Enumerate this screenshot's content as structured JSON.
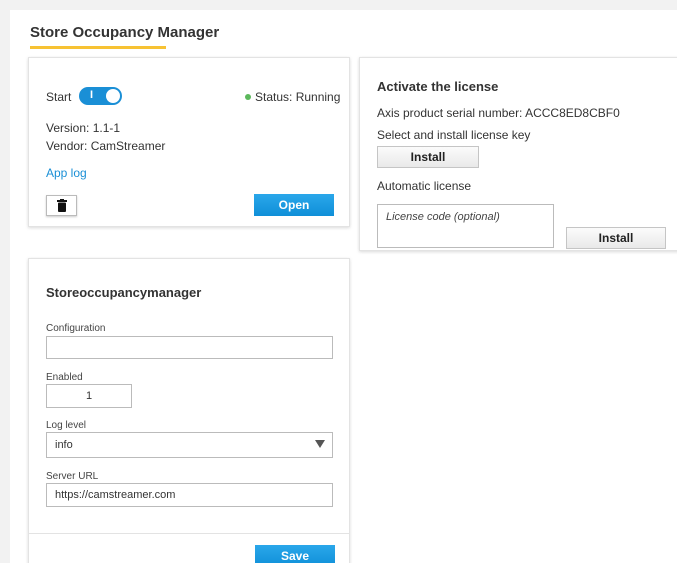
{
  "page": {
    "title": "Store Occupancy Manager"
  },
  "app_card": {
    "start_label": "Start",
    "toggle_mark": "I",
    "status_text": "Status: Running",
    "version": "Version: 1.1-1",
    "vendor": "Vendor: CamStreamer",
    "app_log": "App log",
    "open_label": "Open",
    "trash_icon": "trash-icon"
  },
  "license_card": {
    "title": "Activate the license",
    "serial": "Axis product serial number: ACCC8ED8CBF0",
    "select_install": "Select and install license key",
    "install_label": "Install",
    "automatic": "Automatic license",
    "license_placeholder": "License code (optional)",
    "install_label_2": "Install"
  },
  "settings_card": {
    "title": "Storeoccupancymanager",
    "configuration_label": "Configuration",
    "configuration_value": "",
    "enabled_label": "Enabled",
    "enabled_value": "1",
    "log_level_label": "Log level",
    "log_level_value": "info",
    "server_url_label": "Server URL",
    "server_url_value": "https://camstreamer.com",
    "save_label": "Save"
  },
  "colors": {
    "accent": "#1a8fd6",
    "status_ok": "#5cb85c",
    "title_underline": "#f7c233"
  }
}
